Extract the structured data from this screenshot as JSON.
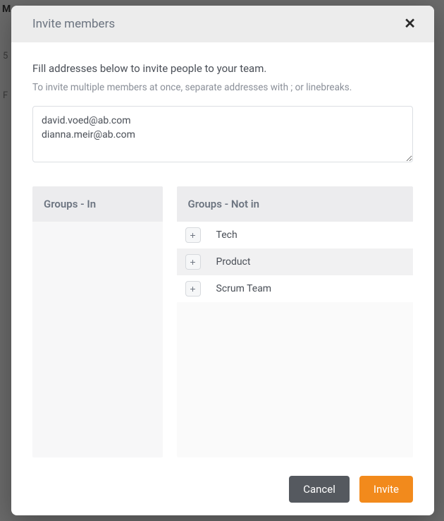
{
  "backdrop": {
    "label_m": "M",
    "label_5": "5",
    "label_f": "F"
  },
  "modal": {
    "title": "Invite members",
    "instruction": "Fill addresses below to invite people to your team.",
    "subinstruction": "To invite multiple members at once, separate addresses with ; or linebreaks.",
    "addresses_value": "david.voed@ab.com\ndianna.meir@ab.com",
    "groups_in": {
      "header": "Groups - In",
      "items": []
    },
    "groups_not_in": {
      "header": "Groups - Not in",
      "items": [
        {
          "label": "Tech"
        },
        {
          "label": "Product"
        },
        {
          "label": "Scrum Team"
        }
      ]
    },
    "buttons": {
      "cancel": "Cancel",
      "invite": "Invite"
    }
  }
}
